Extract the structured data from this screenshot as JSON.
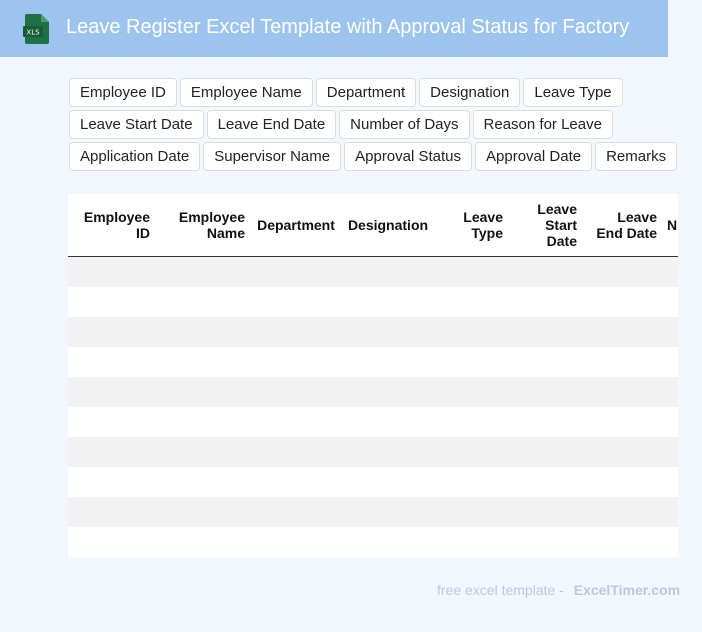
{
  "header": {
    "icon_label": "XLS",
    "title": "Leave Register Excel Template with Approval Status for Factory"
  },
  "fields": [
    [
      "Employee ID",
      "Employee Name",
      "Department",
      "Designation",
      "Leave Type"
    ],
    [
      "Leave Start Date",
      "Leave End Date",
      "Number of Days",
      "Reason for Leave"
    ],
    [
      "Application Date",
      "Supervisor Name",
      "Approval Status",
      "Approval Date",
      "Remarks"
    ]
  ],
  "table": {
    "columns": [
      "Employee ID",
      "Employee Name",
      "Department",
      "Designation",
      "Leave Type",
      "Leave Start Date",
      "Leave End Date",
      "N"
    ],
    "row_count": 10
  },
  "footer": {
    "text": "free excel template -",
    "brand": "ExcelTimer.com"
  },
  "colors": {
    "header_bg": "#9cc4ef",
    "page_bg": "#f2f7fe",
    "icon_green": "#1e7145"
  }
}
